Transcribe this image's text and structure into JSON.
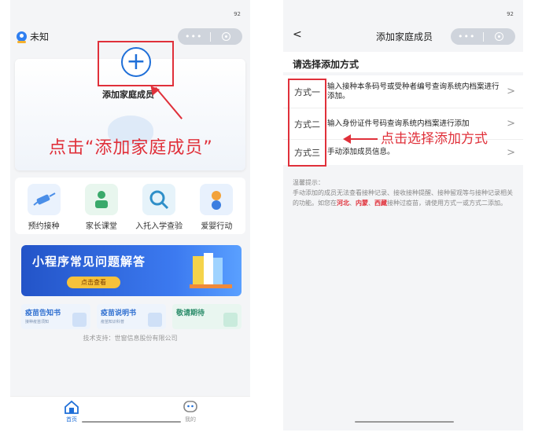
{
  "left": {
    "status_time": "92",
    "location": "未知",
    "add_member_label": "添加家庭成员",
    "annotation": "点击“添加家庭成员”",
    "menu": [
      {
        "label": "预约接种",
        "icon": "syringe-icon"
      },
      {
        "label": "家长课堂",
        "icon": "parent-class-icon"
      },
      {
        "label": "入托入学查验",
        "icon": "enrollment-check-icon"
      },
      {
        "label": "爱婴行动",
        "icon": "baby-care-icon"
      }
    ],
    "faq": {
      "title": "小程序常见问题解答",
      "button": "点击查看"
    },
    "cards": [
      {
        "title": "疫苗告知书",
        "sub": "接种疫苗须知"
      },
      {
        "title": "疫苗说明书",
        "sub": "疫苗知识科普"
      },
      {
        "title": "敬请期待",
        "sub": ""
      }
    ],
    "tech_support": "技术支持：世窗信息股份有限公司",
    "tabs": [
      {
        "label": "首页",
        "icon": "home-icon"
      },
      {
        "label": "我的",
        "icon": "profile-icon"
      }
    ]
  },
  "right": {
    "status_time": "92",
    "back": "<",
    "title": "添加家庭成员",
    "section_title": "请选择添加方式",
    "options": [
      {
        "name": "方式一",
        "desc": "输入接种本条码号或受种者编号查询系统内档案进行添加。"
      },
      {
        "name": "方式二",
        "desc": "输入身份证件号码查询系统内档案进行添加"
      },
      {
        "name": "方式三",
        "desc": "手动添加成员信息。"
      }
    ],
    "chevron": ">",
    "annotation": "点击选择添加方式",
    "tips": {
      "title": "温馨提示：",
      "body_1": "手动添加的成员无法查看接种记录、接收接种提醒、接种留观等与接种记录相关的功能。如您在",
      "r1": "河北",
      "sep1": "、",
      "r2": "内蒙",
      "sep2": "、",
      "r3": "西藏",
      "body_2": "接种过疫苗，请使用方式一或方式二添加。"
    }
  },
  "colors": {
    "accent": "#1f6fd8",
    "annotation": "#e0303a"
  }
}
